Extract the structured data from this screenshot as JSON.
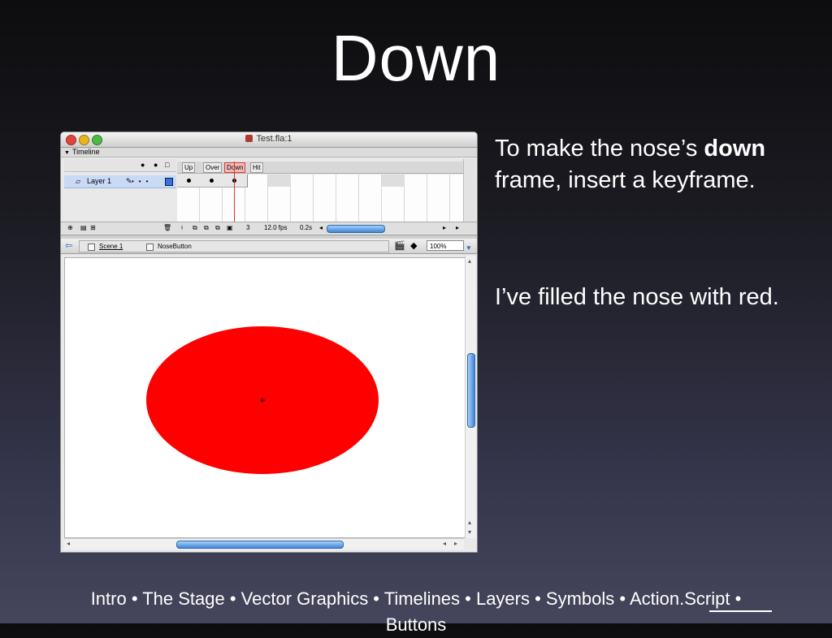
{
  "slide": {
    "title": "Down",
    "bullet1_pre": "To make the nose’s ",
    "bullet1_bold": "down",
    "bullet1_post": " frame, insert a keyframe.",
    "bullet2": "I’ve filled the nose with red.",
    "nav_line1": "Intro • The Stage • Vector Graphics • Timelines • Layers • Symbols • Action.Script •",
    "nav_line2": "Buttons"
  },
  "window": {
    "title": "Test.fla:1",
    "timeline_label": "Timeline",
    "frame_labels": [
      "Up",
      "Over",
      "Down",
      "Hit"
    ],
    "active_frame": "Down",
    "layer_name": "Layer 1",
    "current_frame": "3",
    "fps": "12.0 fps",
    "time": "0.2s",
    "scene": "Scene 1",
    "symbol": "NoseButton",
    "zoom": "100%"
  },
  "colors": {
    "nose_fill": "#ff0000",
    "active_frame_highlight": "#f6b7b7"
  }
}
